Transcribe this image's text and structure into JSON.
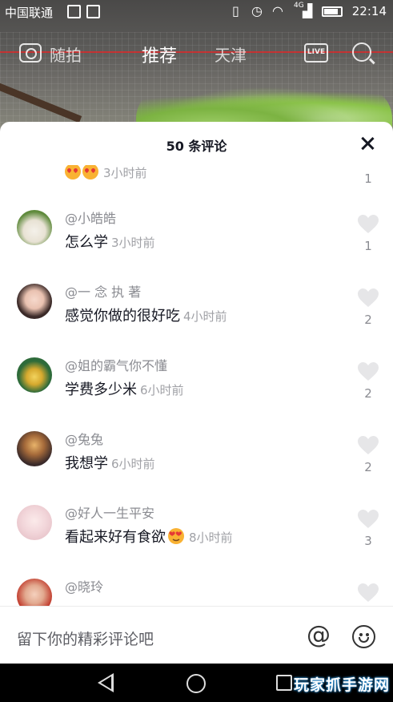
{
  "status_bar": {
    "carrier": "中国联通",
    "network": "4G",
    "time": "22:14"
  },
  "top_nav": {
    "tabs": [
      "随拍",
      "推荐",
      "天津"
    ],
    "active_tab": "推荐",
    "live_label": "LIVE"
  },
  "comments_panel": {
    "title": "50 条评论",
    "partial_top": {
      "time": "3小时前",
      "likes": "1"
    },
    "comments": [
      {
        "username": "@小皓皓",
        "text": "怎么学",
        "time": "3小时前",
        "likes": "1"
      },
      {
        "username": "@一 念 执 著",
        "text": "感觉你做的很好吃",
        "time": "4小时前",
        "likes": "2"
      },
      {
        "username": "@姐的霸气你不懂",
        "text": "学费多少米",
        "time": "6小时前",
        "likes": "2"
      },
      {
        "username": "@兔兔",
        "text": "我想学",
        "time": "6小时前",
        "likes": "2"
      },
      {
        "username": "@好人一生平安",
        "text": "看起来好有食欲",
        "time": "8小时前",
        "likes": "3",
        "emoji": "heart-eyes"
      },
      {
        "username": "@晓玲",
        "text": "",
        "time": "",
        "likes": ""
      }
    ],
    "input_placeholder": "留下你的精彩评论吧"
  },
  "watermark": "玩家抓手游网",
  "colors": {
    "sheet_bg": "#ffffff",
    "text_primary": "#161823",
    "text_secondary": "#8a8b91",
    "heart": "#e6e6e8"
  }
}
